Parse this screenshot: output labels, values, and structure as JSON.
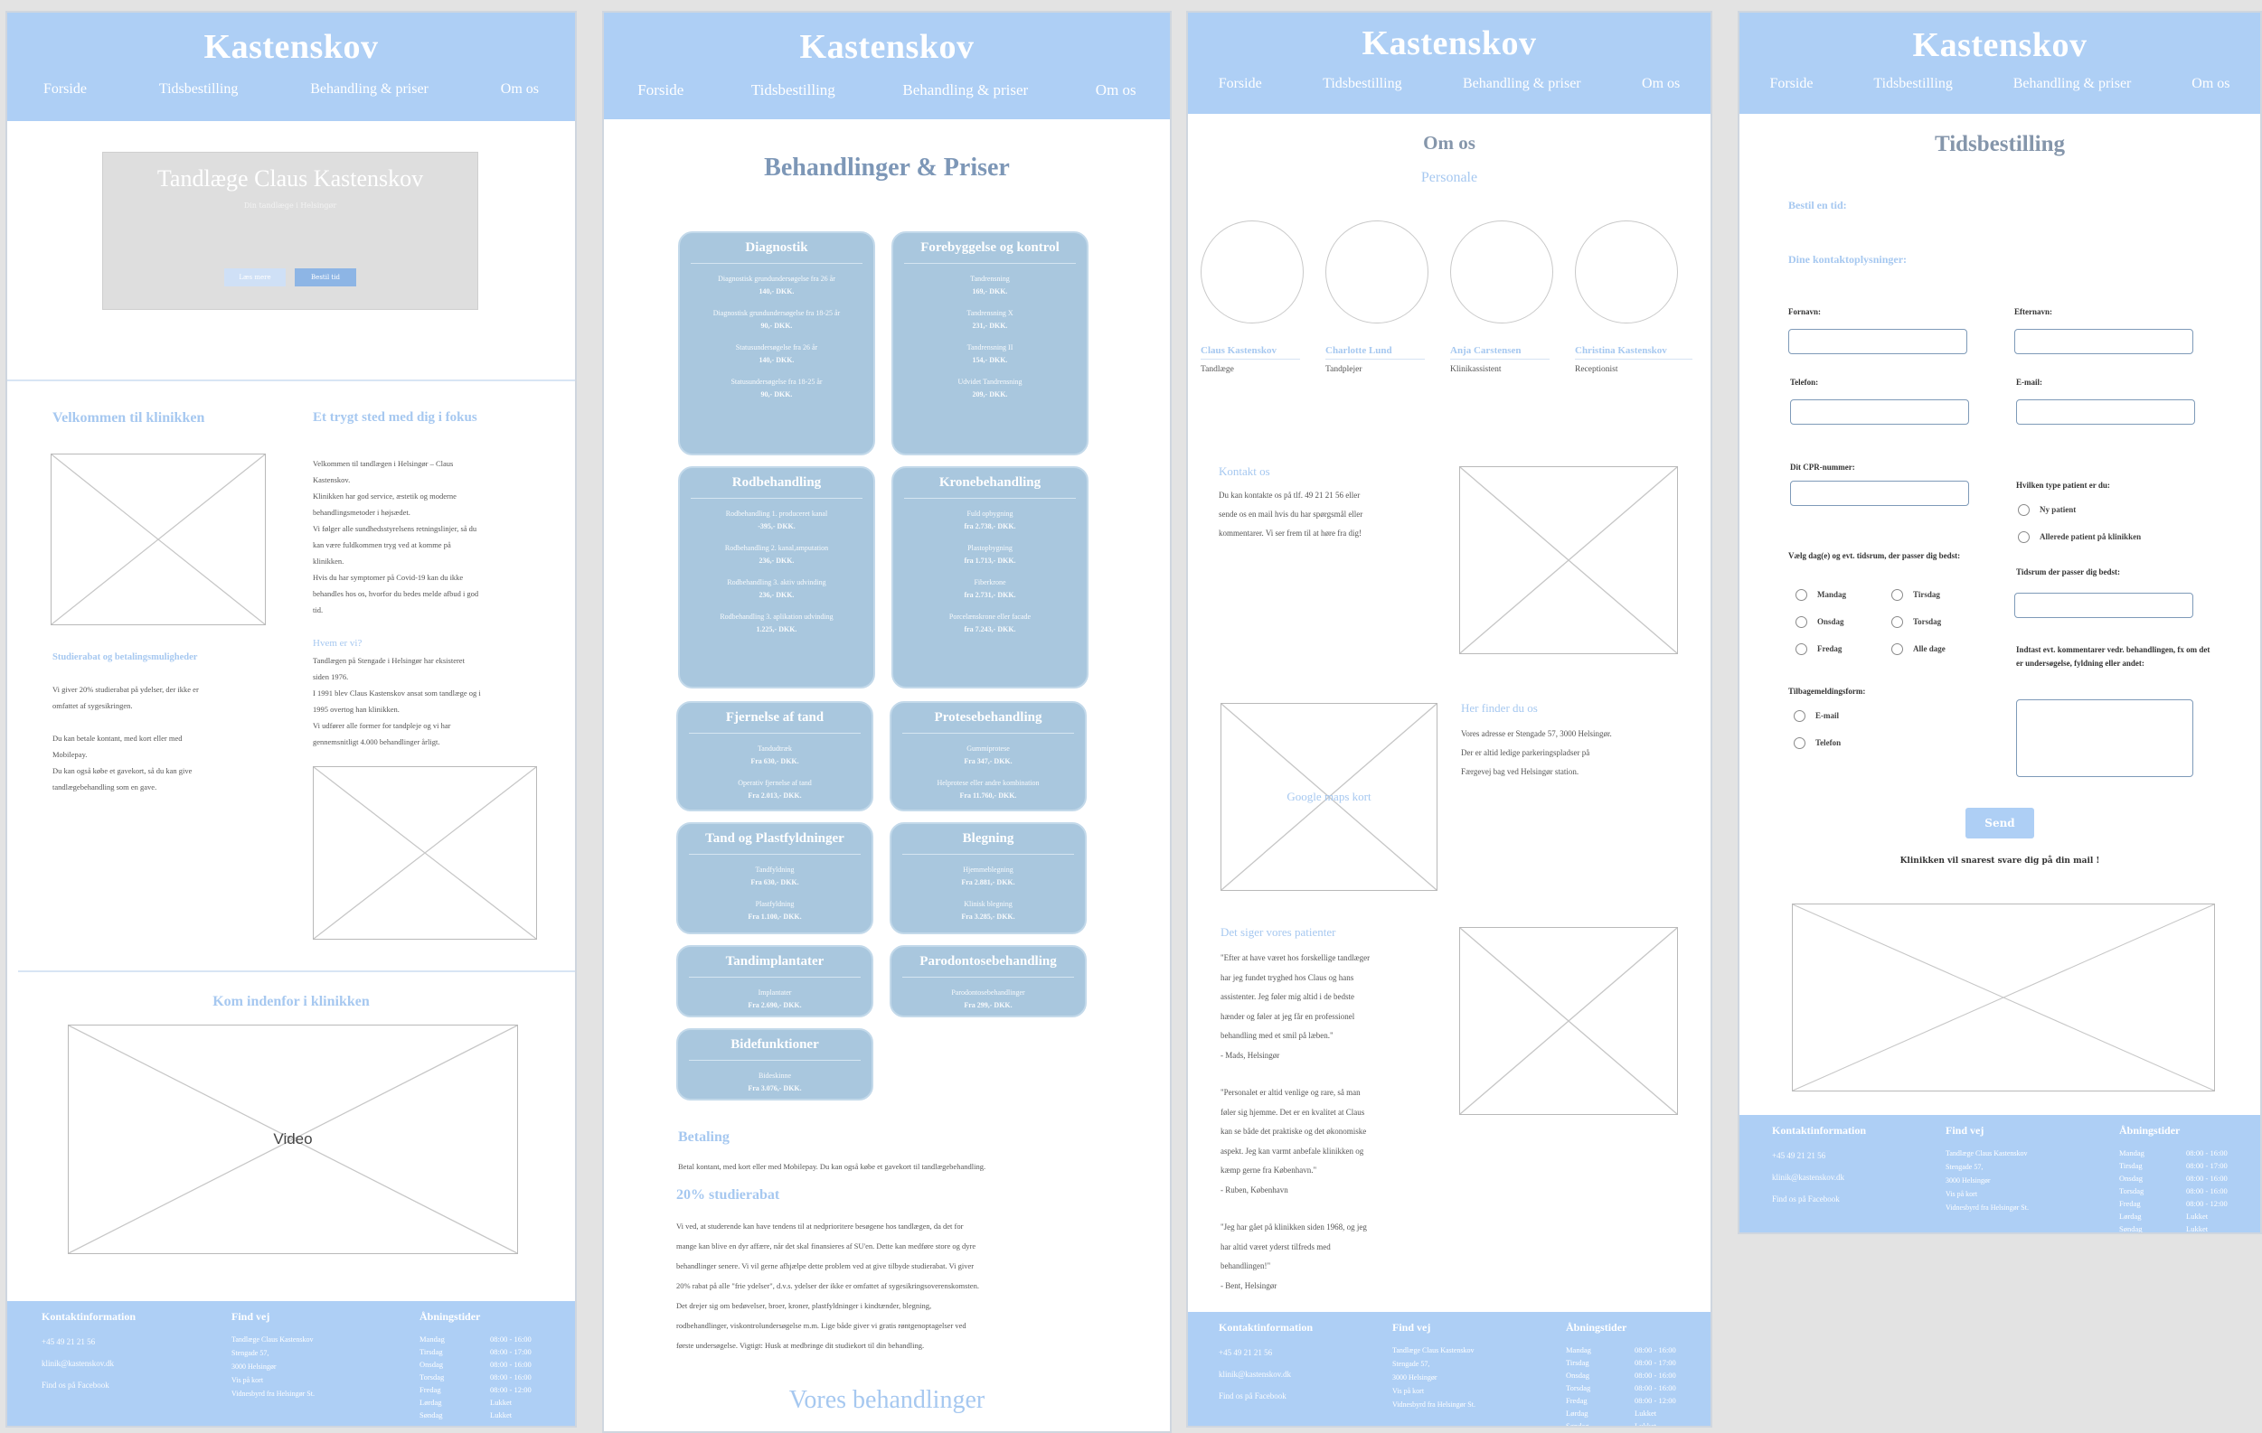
{
  "site": {
    "brand": "Kastenskov",
    "nav": [
      "Forside",
      "Tidsbestilling",
      "Behandling & priser",
      "Om os"
    ]
  },
  "footer": {
    "contact_title": "Kontaktinformation",
    "phone": "+45 49 21 21 56",
    "email": "klinik@kastenskov.dk",
    "facebook": "Find os på Facebook",
    "find_title": "Find vej",
    "address": [
      "Tandlæge Claus Kastenskov",
      "Stengade 57,",
      "3000 Helsingør",
      "Vis på kort",
      "Vidnesbyrd fra Helsingør St."
    ],
    "hours_title": "Åbningstider",
    "hours": [
      [
        "Mandag",
        "08:00 - 16:00"
      ],
      [
        "Tirsdag",
        "08:00 - 17:00"
      ],
      [
        "Onsdag",
        "08:00 - 16:00"
      ],
      [
        "Torsdag",
        "08:00 - 16:00"
      ],
      [
        "Fredag",
        "08:00 - 12:00"
      ],
      [
        "Lørdag",
        "Lukket"
      ],
      [
        "Søndag",
        "Lukket"
      ]
    ]
  },
  "forside": {
    "hero_title": "Tandlæge Claus Kastenskov",
    "hero_sub": "Din tandlæge i Helsingør",
    "hero_btn1": "Læs mere",
    "hero_btn2": "Bestil tid",
    "welcome_title": "Velkommen til klinikken",
    "focus_title": "Et trygt sted med dig i fokus",
    "focus_text": [
      "Velkommen til tandlægen i Helsingør – Claus",
      "Kastenskov.",
      "Klinikken har god service, æstetik og moderne",
      "behandlingsmetoder i højsædet.",
      "Vi følger alle sundhedsstyrelsens retningslinjer, så du",
      "kan være fuldkommen tryg ved at komme på",
      "klinikken.",
      "Hvis du har symptomer på Covid-19 kan du ikke",
      "behandles hos os, hvorfor du bedes melde afbud i god",
      "tid."
    ],
    "who_title": "Hvem er vi?",
    "who_text": [
      "Tandlægen på Stengade i Helsingør har eksisteret",
      "siden 1976.",
      "I 1991 blev Claus Kastenskov ansat som tandlæge og i",
      "1995 overtog han klinikken.",
      "Vi udfører alle former for tandpleje og vi har",
      "gennemsnitligt 4.000 behandlinger årligt."
    ],
    "student_title": "Studierabat og betalingsmuligheder",
    "student_text": [
      "Vi giver 20% studierabat på ydelser, der ikke er",
      "omfattet af sygesikringen.",
      "",
      "Du kan betale kontant, med kort eller med",
      "Mobilepay.",
      "Du kan også købe et gavekort, så du kan give",
      "tandlægebehandling som en gave."
    ],
    "video_section": "Kom indenfor i klinikken",
    "video_label": "Video"
  },
  "behandlinger": {
    "title": "Behandlinger & Priser",
    "cards": [
      {
        "title": "Diagnostik",
        "items": [
          [
            "Diagnostisk grundundersøgelse fra 26 år",
            "140,- DKK."
          ],
          [
            "Diagnostisk grundundersøgelse fra 18-25 år",
            "90,- DKK."
          ],
          [
            "Statusundersøgelse fra 26 år",
            "140,- DKK."
          ],
          [
            "Statusundersøgelse fra 18-25 år",
            "90,- DKK."
          ]
        ]
      },
      {
        "title": "Forebyggelse og kontrol",
        "items": [
          [
            "Tandrensning",
            "169,- DKK."
          ],
          [
            "Tandrensning X",
            "231,- DKK."
          ],
          [
            "Tandrensning II",
            "154,- DKK."
          ],
          [
            "Udvidet Tandrensning",
            "209,- DKK."
          ]
        ]
      },
      {
        "title": "Rodbehandling",
        "items": [
          [
            "Rodbehandling 1. produceret kanal",
            "-395,- DKK."
          ],
          [
            "Rodbehandling 2. kanal,amputation",
            "236,- DKK."
          ],
          [
            "Rodbehandling 3. aktiv udvinding",
            "236,- DKK."
          ],
          [
            "Rodbehandling 3. aplikation udvinding",
            "1.225,- DKK."
          ]
        ]
      },
      {
        "title": "Kronebehandling",
        "items": [
          [
            "Fuld opbygning",
            "fra 2.738,- DKK."
          ],
          [
            "Plastopbygning",
            "fra 1.713,- DKK."
          ],
          [
            "Fiberkrone",
            "fra 2.731,- DKK."
          ],
          [
            "Porcelænskrone eller facade",
            "fra 7.243,- DKK."
          ]
        ]
      },
      {
        "title": "Fjernelse af tand",
        "items": [
          [
            "Tandudtræk",
            "Fra 630,- DKK."
          ],
          [
            "Operativ fjernelse af tand",
            "Fra 2.013,- DKK."
          ]
        ]
      },
      {
        "title": "Protesebehandling",
        "items": [
          [
            "Gummiprotese",
            "Fra 347,- DKK."
          ],
          [
            "Helprotese eller andre kombination",
            "Fra 11.760,- DKK."
          ]
        ]
      },
      {
        "title": "Tand og Plastfyldninger",
        "items": [
          [
            "Tandfyldning",
            "Fra 630,- DKK."
          ],
          [
            "Plastfyldning",
            "Fra 1.100,- DKK."
          ]
        ]
      },
      {
        "title": "Blegning",
        "items": [
          [
            "Hjemmeblegning",
            "Fra 2.881,- DKK."
          ],
          [
            "Klinisk blegning",
            "Fra 3.285,- DKK."
          ]
        ]
      },
      {
        "title": "Tandimplantater",
        "items": [
          [
            "Implantater",
            "Fra 2.690,- DKK."
          ]
        ]
      },
      {
        "title": "Parodontosebehandling",
        "items": [
          [
            "Parodontosebehandlinger",
            "Fra 299,- DKK."
          ]
        ]
      },
      {
        "title": "Bidefunktioner",
        "items": [
          [
            "Bideskinne",
            "Fra 3.076,- DKK."
          ]
        ]
      }
    ],
    "payment_title": "Betaling",
    "payment_text": "Betal kontant, med kort eller med Mobilepay. Du kan også købe et gavekort til tandlægebehandling.",
    "student_title": "20% studierabat",
    "student_text": [
      "Vi ved, at studerende kan have tendens til at nedprioritere besøgene hos tandlægen, da det for",
      "mange kan blive en dyr affære, når det skal finansieres af SU'en. Dette kan medføre store og dyre",
      "behandlinger senere. Vi vil gerne afhjælpe dette problem ved at give tilbyde studierabat. Vi giver",
      "20% rabat på alle \"frie ydelser\", d.v.s. ydelser der ikke er omfattet af sygesikringsoverenskomsten.",
      "Det drejer sig om bedøvelser, broer, kroner, plastfyldninger i kindtænder, blegning,",
      "rodbehandlinger, viskontrolundersøgelse m.m. Lige både giver vi gratis røntgenoptagelser ved",
      "første undersøgelse. Vigtigt: Husk at medbringe dit studiekort til din behandling."
    ],
    "bottom_title": "Vores behandlinger"
  },
  "omos": {
    "title": "Om os",
    "subtitle": "Personale",
    "staff": [
      {
        "name": "Claus Kastenskov",
        "role": "Tandlæge"
      },
      {
        "name": "Charlotte Lund",
        "role": "Tandplejer"
      },
      {
        "name": "Anja Carstensen",
        "role": "Klinikassistent"
      },
      {
        "name": "Christina Kastenskov",
        "role": "Receptionist"
      }
    ],
    "contact_title": "Kontakt os",
    "contact_text": [
      "Du kan kontakte os på tlf. 49 21 21 56 eller",
      "sende os en mail hvis du har spørgsmål eller",
      "kommentarer. Vi ser frem til at høre fra dig!"
    ],
    "map_label": "Google maps kort",
    "find_title": "Her finder du os",
    "find_text": [
      "Vores adresse er Stengade 57, 3000 Helsingør.",
      "Der er altid ledige parkeringspladser på",
      "Færgevej bag ved Helsingør station."
    ],
    "reviews_title": "Det siger vores patienter",
    "reviews": [
      [
        "\"Efter at have været hos forskellige tandlæger",
        "har jeg fundet tryghed hos Claus og hans",
        "assistenter. Jeg føler mig altid i de bedste",
        "hænder og føler at jeg får en professionel",
        "behandling med et smil på læben.\"",
        "- Mads, Helsingør"
      ],
      [
        "\"Personalet er altid venlige og rare, så man",
        "føler sig hjemme. Det er en kvalitet at Claus",
        "kan se både det praktiske og det økonomiske",
        "aspekt. Jeg kan varmt anbefale klinikken og",
        "kæmp gerne fra København.\"",
        "- Ruben, København"
      ],
      [
        "\"Jeg har gået på klinikken siden 1968, og jeg",
        "har altid været yderst tilfreds med",
        "behandlingen!\"",
        "- Bent, Helsingør"
      ]
    ]
  },
  "tidsbestilling": {
    "title": "Tidsbestilling",
    "book_title": "Bestil en tid:",
    "contact_title": "Dine kontaktoplysninger:",
    "first_name": "Fornavn:",
    "last_name": "Efternavn:",
    "phone": "Telefon:",
    "email": "E-mail:",
    "cpr": "Dit CPR-nummer:",
    "patient_q": "Hvilken type patient er du:",
    "patient_opts": [
      "Ny patient",
      "Allerede patient på klinikken"
    ],
    "days_q": "Vælg dag(e) og evt. tidsrum, der passer dig bedst:",
    "days": [
      "Mandag",
      "Tirsdag",
      "Onsdag",
      "Torsdag",
      "Fredag",
      "Alle dage"
    ],
    "time_q": "Tidsrum der passer dig bedst:",
    "comment_q": "Indtast evt. kommentarer vedr. behandlingen, fx om det er undersøgelse, fyldning eller andet:",
    "feedback_q": "Tilbagemeldingsform:",
    "feedback_opts": [
      "E-mail",
      "Telefon"
    ],
    "send": "Send",
    "confirm": "Klinikken vil snarest svare dig på din mail !"
  }
}
